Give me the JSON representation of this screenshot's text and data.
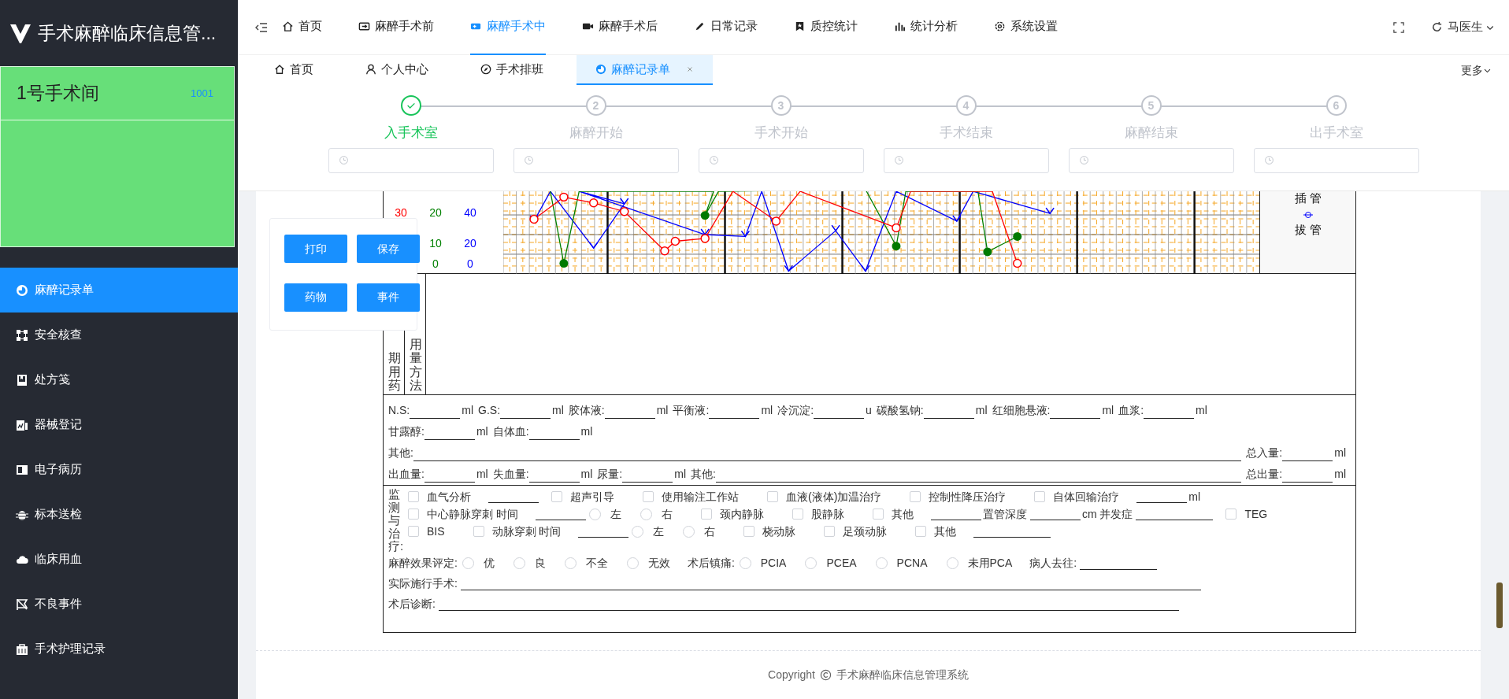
{
  "app": {
    "title": "手术麻醉临床信息管..."
  },
  "room_card": {
    "name": "1号手术间",
    "code": "1001"
  },
  "sidebar": {
    "items": [
      {
        "label": "麻醉记录单",
        "selected": true
      },
      {
        "label": "安全核查",
        "selected": false
      },
      {
        "label": "处方笺",
        "selected": false
      },
      {
        "label": "器械登记",
        "selected": false
      },
      {
        "label": "电子病历",
        "selected": false
      },
      {
        "label": "标本送检",
        "selected": false
      },
      {
        "label": "临床用血",
        "selected": false
      },
      {
        "label": "不良事件",
        "selected": false
      },
      {
        "label": "手术护理记录",
        "selected": false
      }
    ]
  },
  "top_nav": {
    "items": [
      {
        "label": "首页",
        "selected": false
      },
      {
        "label": "麻醉手术前",
        "selected": false
      },
      {
        "label": "麻醉手术中",
        "selected": true
      },
      {
        "label": "麻醉手术后",
        "selected": false
      },
      {
        "label": "日常记录",
        "selected": false
      },
      {
        "label": "质控统计",
        "selected": false
      },
      {
        "label": "统计分析",
        "selected": false
      },
      {
        "label": "系统设置",
        "selected": false
      }
    ],
    "user": "马医生"
  },
  "tabs": {
    "items": [
      {
        "label": "首页",
        "selected": false,
        "closable": false
      },
      {
        "label": "个人中心",
        "selected": false,
        "closable": false
      },
      {
        "label": "手术排班",
        "selected": false,
        "closable": false
      },
      {
        "label": "麻醉记录单",
        "selected": true,
        "closable": true
      }
    ],
    "more": "更多"
  },
  "steps": [
    {
      "label": "入手术室",
      "done": true
    },
    {
      "number": "2",
      "label": "麻醉开始",
      "done": false
    },
    {
      "number": "3",
      "label": "手术开始",
      "done": false
    },
    {
      "number": "4",
      "label": "手术结束",
      "done": false
    },
    {
      "number": "5",
      "label": "麻醉结束",
      "done": false
    },
    {
      "number": "6",
      "label": "出手术室",
      "done": false
    }
  ],
  "action_buttons": [
    "打印",
    "保存",
    "药物",
    "事件"
  ],
  "chart": {
    "scale_columns": [
      {
        "color": "#ff0000",
        "labels": [
          "30"
        ]
      },
      {
        "color": "#008000",
        "labels": [
          "20",
          "10",
          "0"
        ]
      },
      {
        "color": "#0000ff",
        "labels": [
          "40",
          "20",
          "0"
        ]
      }
    ],
    "legend": [
      {
        "label": "插 管",
        "marker": false
      },
      {
        "label": "拔 管",
        "marker": true
      }
    ]
  },
  "medication": {
    "labels": [
      "期用药",
      "用量方法"
    ]
  },
  "fluids": {
    "lines": [
      [
        {
          "kind": "field",
          "label": "N.S:",
          "unit": "ml"
        },
        {
          "kind": "field",
          "label": "G.S:",
          "unit": "ml"
        },
        {
          "kind": "field",
          "label": "胶体液:",
          "unit": "ml"
        },
        {
          "kind": "field",
          "label": "平衡液:",
          "unit": "ml"
        },
        {
          "kind": "field",
          "label": "冷沉淀:",
          "unit": "u"
        },
        {
          "kind": "field",
          "label": "碳酸氢钠:",
          "unit": "ml"
        },
        {
          "kind": "field",
          "label": "红细胞悬液:",
          "unit": "ml"
        },
        {
          "kind": "field",
          "label": "血浆:",
          "unit": "ml"
        }
      ],
      [
        {
          "kind": "field",
          "label": "甘露醇:",
          "unit": "ml"
        },
        {
          "kind": "field",
          "label": "自体血:",
          "unit": "ml"
        }
      ],
      [
        {
          "kind": "long",
          "label": "其他:"
        },
        {
          "kind": "field",
          "label": "总入量:",
          "unit": "ml"
        }
      ],
      [
        {
          "kind": "field",
          "label": "出血量:",
          "unit": "ml"
        },
        {
          "kind": "field",
          "label": "失血量:",
          "unit": "ml"
        },
        {
          "kind": "field",
          "label": "尿量:",
          "unit": "ml"
        },
        {
          "kind": "long",
          "label": "其他:"
        },
        {
          "kind": "field",
          "label": "总出量:",
          "unit": "ml"
        }
      ]
    ]
  },
  "monitoring": {
    "label": "监测与治疗:",
    "lines": [
      [
        {
          "kind": "checkbox",
          "label": "血气分析",
          "checked": false
        },
        {
          "kind": "blank"
        },
        {
          "kind": "checkbox",
          "label": "超声引导",
          "checked": false
        },
        {
          "kind": "checkbox",
          "label": "使用输注工作站",
          "checked": false
        },
        {
          "kind": "checkbox",
          "label": "血液(液体)加温治疗",
          "checked": false
        },
        {
          "kind": "checkbox",
          "label": "控制性降压治疗",
          "checked": false
        },
        {
          "kind": "checkbox",
          "label": "自体回输治疗",
          "checked": false
        },
        {
          "kind": "blank"
        },
        {
          "kind": "text",
          "text": "ml"
        }
      ],
      [
        {
          "kind": "checkbox",
          "label": "中心静脉穿刺 时间",
          "checked": false
        },
        {
          "kind": "blank"
        },
        {
          "kind": "radio",
          "label": "左",
          "selected": false
        },
        {
          "kind": "radio",
          "label": "右",
          "selected": false
        },
        {
          "kind": "checkbox",
          "label": "颈内静脉",
          "checked": false
        },
        {
          "kind": "checkbox",
          "label": "股静脉",
          "checked": false
        },
        {
          "kind": "checkbox",
          "label": "其他",
          "checked": false
        },
        {
          "kind": "blank"
        },
        {
          "kind": "text",
          "text": "置管深度"
        },
        {
          "kind": "blank"
        },
        {
          "kind": "text",
          "text": "cm 并发症"
        },
        {
          "kind": "wide_blank"
        },
        {
          "kind": "checkbox",
          "label": "TEG",
          "checked": false
        }
      ],
      [
        {
          "kind": "checkbox",
          "label": "BIS",
          "checked": false
        },
        {
          "kind": "checkbox",
          "label": "动脉穿刺 时间",
          "checked": false
        },
        {
          "kind": "blank"
        },
        {
          "kind": "radio",
          "label": "左",
          "selected": false
        },
        {
          "kind": "radio",
          "label": "右",
          "selected": false
        },
        {
          "kind": "checkbox",
          "label": "桡动脉",
          "checked": false
        },
        {
          "kind": "checkbox",
          "label": "足颈动脉",
          "checked": false
        },
        {
          "kind": "checkbox",
          "label": "其他",
          "checked": false
        },
        {
          "kind": "wide_blank"
        }
      ]
    ]
  },
  "evaluation": {
    "lines": [
      [
        {
          "kind": "text",
          "text": "麻醉效果评定:"
        },
        {
          "kind": "radio",
          "label": "优",
          "selected": false
        },
        {
          "kind": "radio",
          "label": "良",
          "selected": false
        },
        {
          "kind": "radio",
          "label": "不全",
          "selected": false
        },
        {
          "kind": "radio",
          "label": "无效",
          "selected": false
        },
        {
          "kind": "text",
          "text": "术后镇痛:"
        },
        {
          "kind": "radio",
          "label": "PCIA",
          "selected": false
        },
        {
          "kind": "radio",
          "label": "PCEA",
          "selected": false
        },
        {
          "kind": "radio",
          "label": "PCNA",
          "selected": false
        },
        {
          "kind": "radio",
          "label": "未用PCA",
          "selected": false
        },
        {
          "kind": "text",
          "text": "病人去往:"
        },
        {
          "kind": "wide_blank"
        }
      ],
      [
        {
          "kind": "text",
          "text": "实际施行手术:"
        },
        {
          "kind": "line"
        }
      ],
      [
        {
          "kind": "text",
          "text": "术后诊断:"
        },
        {
          "kind": "line"
        }
      ]
    ]
  },
  "footer": {
    "copyright": "Copyright",
    "system": "手术麻醉临床信息管理系统"
  }
}
